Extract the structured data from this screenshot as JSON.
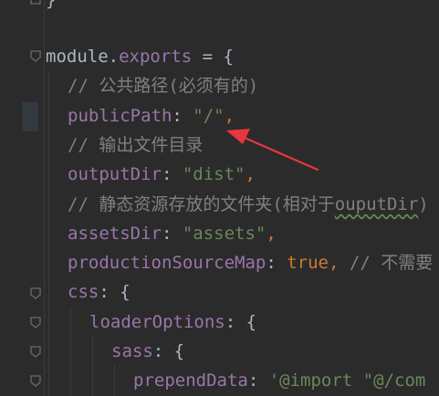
{
  "code": {
    "top_brace": "}",
    "l1_module": "module",
    "l1_dot": ".",
    "l1_exports": "exports",
    "l1_rest": " = {",
    "l2_comment": "// 公共路径(必须有的)",
    "l3_key": "publicPath",
    "l3_colon": ": ",
    "l3_value": "\"/\"",
    "l3_comma": ",",
    "l4_comment": "// 输出文件目录",
    "l5_key": "outputDir",
    "l5_colon": ": ",
    "l5_value": "\"dist\"",
    "l5_comma": ",",
    "l6_comment_a": "// 静态资源存放的文件夹(相对于",
    "l6_comment_b": "ouputDir",
    "l6_comment_c": ")",
    "l7_key": "assetsDir",
    "l7_colon": ": ",
    "l7_value": "\"assets\"",
    "l7_comma": ",",
    "l8_key": "productionSourceMap",
    "l8_colon": ": ",
    "l8_value": "true",
    "l8_comma": ", ",
    "l8_comment": "// 不需要",
    "l9_key": "css",
    "l9_rest": ": {",
    "l10_key": "loaderOptions",
    "l10_rest": ": {",
    "l11_key": "sass",
    "l11_rest": ": {",
    "l12_key": "prependData",
    "l12_colon": ": ",
    "l12_value": "'@import \"@/com"
  },
  "colors": {
    "background": "#2b2b2b",
    "keyword": "#cc7832",
    "property": "#9876aa",
    "string": "#6a8759",
    "comment": "#808080",
    "annotation_arrow": "#e8363d"
  }
}
